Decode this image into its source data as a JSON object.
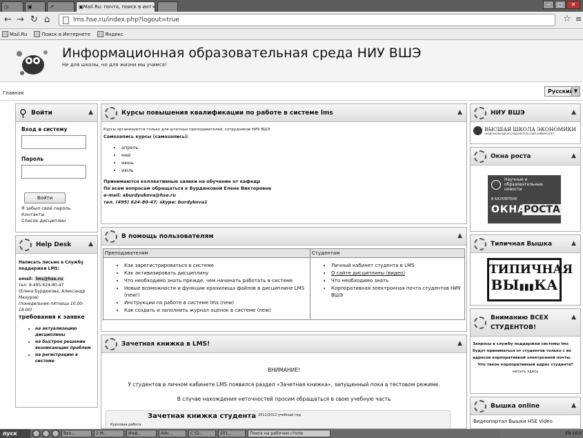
{
  "tabs": [
    {
      "label": "",
      "active": false
    },
    {
      "label": "",
      "active": false
    },
    {
      "label": "",
      "active": false
    },
    {
      "label": "Mail.Ru: почта, поиск в инт",
      "active": true
    }
  ],
  "nav": {
    "url": "lms.hse.ru/index.php?logout=true"
  },
  "bookmarks": [
    "Mail.Ru",
    "Поиск в Интернете",
    "Яндекс"
  ],
  "header": {
    "title": "Информационная образовательная среда НИУ ВШЭ",
    "subtitle": "Не для школы, но для жизни мы учимся!"
  },
  "breadcrumb": "Главная",
  "language": "Русский",
  "login": {
    "title": "Войти",
    "heading": "Вход в систему",
    "password_label": "Пароль",
    "button": "Войти",
    "links": [
      "Я забыл свой пароль",
      "Контакты",
      "Список дисциплин"
    ]
  },
  "helpdesk": {
    "title": "Help Desk",
    "intro": "Написать письмо в Службу поддержки LMS:",
    "email_label": "email:",
    "email": "lms@hse.ru",
    "phone": "тел: 8-495-624-80-47",
    "people": "(Елена Бурдюкова, Александр Мазуров)",
    "hours": "(понедельник-пятница 10.00-18.00)",
    "req_title": "требования к заявке",
    "reqs": [
      "на актуализацию дисциплины",
      "на быстрое решение возникающих проблем",
      "на регистрацию в системе"
    ]
  },
  "courses": {
    "title": "Курсы повышения квалификации по работе в системе lms",
    "note": "Курсы организуются только для штатных преподавателей, сотрудников НИУ ВШЭ",
    "enroll": "Самозапись курсы (самозапись):",
    "months": [
      "апрель",
      "май",
      "июнь",
      "июль"
    ],
    "collective": "Принимаются коллективные заявки на обучение от кафедр",
    "contact": "По всем вопросам обращаться к Бурдюковой Елене Викторовне",
    "email": "e-mail: aburdyukova@hse.ru",
    "tel": "тел. (495) 624-80-47; skype: burdykova1"
  },
  "help": {
    "title": "В помощь пользователям",
    "teachers_header": "Преподавателям",
    "students_header": "Студентам",
    "teachers": [
      "Как зарегистрироваться в системе",
      "Как активизировать дисциплину",
      "Что необходимо знать прежде, чем начинать работать в системе",
      "Новые возможности и функции хранилища файлов в дисциплине LMS (new!)",
      "Инструкции по работе в системе lms (new)",
      "Как создать и заполнить журнал оценок в системе (new)"
    ],
    "students": [
      "Личный кабинет студента в LMS",
      "О сайте дисциплины (видео)",
      "Что необходимо знать",
      "Корпоративная электронная почта студентов НИУ ВШЭ"
    ]
  },
  "gradebook": {
    "title": "Зачетная книжка в LMS!",
    "attention": "ВНИМАНИЕ!",
    "line1": "У студентов в личном кабинете LMS появился раздел «Зачетная книжка», запущенный пока в тестовом режиме.",
    "line2": "В случае нахождения неточностей просим обращаться в свою учебную часть",
    "image_title": "Зачетная книжка студента",
    "image_year": "2011/2012 учебный год",
    "image_row": "Курсовая работа"
  },
  "right": {
    "hse_title": "НИУ ВШЭ",
    "hse_logo1": "ВЫСШАЯ ШКОЛА ЭКОНОМИКИ",
    "hse_logo2": "НАЦИОНАЛЬНЫЙ ИССЛЕДОВАТЕЛЬСКИЙ УНИВЕРСИТЕТ",
    "growth_title": "Окна роста",
    "growth_badge": "Научные и образовательные новости",
    "growth_in": "В БЮЛЛЕТЕНЕ",
    "growth_name1": "ОКНА",
    "growth_name2": "РОСТА",
    "typical_title": "Типичная Вышка",
    "typical_l1": "ТИПИЧНАЯ",
    "typical_l2": "ВЫ",
    "typical_l3": "КА",
    "attention_title": "Вниманию ВСЕХ СТУДЕНТОВ!",
    "attention_text": "Запросы в службу поддержки системы lms будут приниматься от студентов только с их адресов корпоративной электронной почты.",
    "attention_q": "Что такое корпоративный адрес студента?",
    "attention_link": "читать здесь",
    "online_title": "Вышка online",
    "online_text": "Видеопортал Вышки HSE Video"
  },
  "taskbar": {
    "start": "пуск",
    "items": [
      "Вхо...",
      "2 М...",
      "Инф...",
      "Ado...",
      "C:\\D...",
      "201..."
    ],
    "search": "Поиск на рабочем столе",
    "tray": "EN 16:5"
  }
}
